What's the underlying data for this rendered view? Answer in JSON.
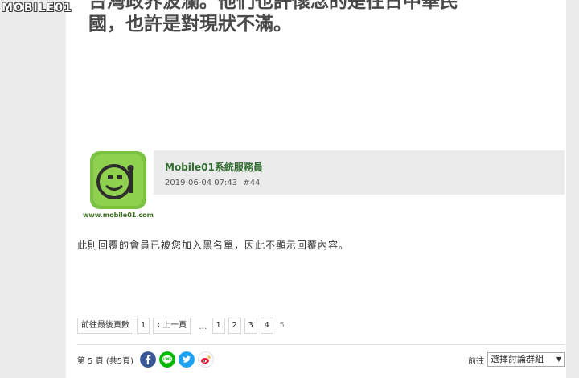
{
  "watermark": {
    "text": "MOBILE01"
  },
  "quote": {
    "line1": "台灣政界波瀾。他們也許懷念的是往日中華民",
    "line2": "國，也許是對現狀不滿。"
  },
  "post": {
    "author": "Mobile01系統服務員",
    "date": "2019-06-04 07:43",
    "floor": "#44",
    "avatar_caption": "www.mobile01.com",
    "body": "此則回覆的會員已被您加入黑名單，因此不顯示回覆內容。"
  },
  "pagination": {
    "first_unread": "前往最後頁數",
    "first_page": "1",
    "prev": "‹ 上一頁",
    "ellipsis": "...",
    "pages": [
      "1",
      "2",
      "3",
      "4"
    ],
    "current": "5"
  },
  "footer": {
    "page_info": "第 5 頁 (共5頁)",
    "goto_label": "前往",
    "select_value": "選擇討論群組",
    "social": [
      {
        "name": "facebook-icon",
        "color": "#3b5998"
      },
      {
        "name": "line-icon",
        "color": "#00b900"
      },
      {
        "name": "twitter-icon",
        "color": "#1da1f2"
      },
      {
        "name": "weibo-icon",
        "color": "#e6162d"
      }
    ]
  }
}
